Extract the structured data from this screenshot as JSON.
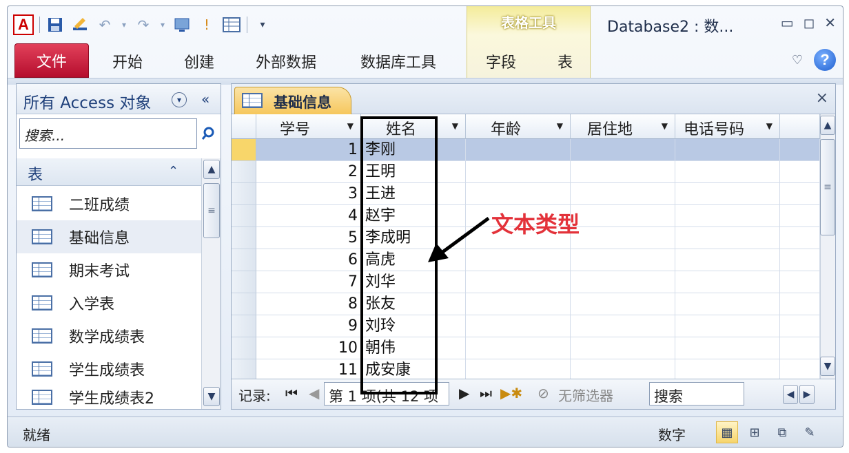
{
  "app": {
    "db_title": "Database2 : 数...",
    "context_tab_group": "表格工具"
  },
  "ribbon": {
    "file_tab": "文件",
    "tabs": [
      "开始",
      "创建",
      "外部数据",
      "数据库工具"
    ],
    "context_tabs": [
      "字段",
      "表"
    ]
  },
  "nav": {
    "title": "所有 Access 对象",
    "collapse": "«",
    "search_placeholder": "搜索...",
    "group_title": "表",
    "items": [
      "二班成绩",
      "基础信息",
      "期末考试",
      "入学表",
      "数学成绩表",
      "学生成绩表",
      "学生成绩表2"
    ],
    "selected_index": 1
  },
  "document": {
    "tab_label": "基础信息",
    "close_symbol": "×",
    "columns": [
      "学号",
      "姓名",
      "年龄",
      "居住地",
      "电话号码"
    ],
    "rows": [
      {
        "id": "1",
        "name": "李刚"
      },
      {
        "id": "2",
        "name": "王明"
      },
      {
        "id": "3",
        "name": "王进"
      },
      {
        "id": "4",
        "name": "赵宇"
      },
      {
        "id": "5",
        "name": "李成明"
      },
      {
        "id": "6",
        "name": "高虎"
      },
      {
        "id": "7",
        "name": "刘华"
      },
      {
        "id": "8",
        "name": "张友"
      },
      {
        "id": "9",
        "name": "刘玲"
      },
      {
        "id": "10",
        "name": "朝伟"
      },
      {
        "id": "11",
        "name": "成安康"
      }
    ]
  },
  "record_nav": {
    "label": "记录:",
    "position": "第 1 项(共 12 项",
    "filter": "无筛选器",
    "search": "搜索"
  },
  "annotation": {
    "text": "文本类型",
    "color": "#e3323a"
  },
  "status": {
    "left": "就绪",
    "right": "数字"
  }
}
